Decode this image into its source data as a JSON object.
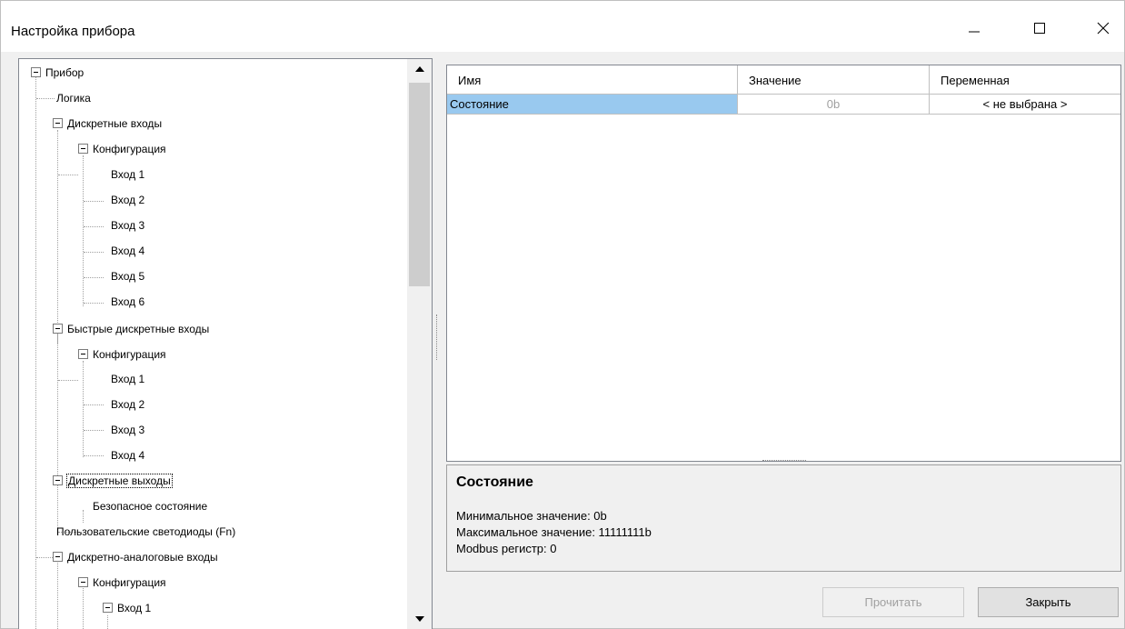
{
  "window": {
    "title": "Настройка прибора"
  },
  "tree": {
    "nodes": [
      {
        "label": "Прибор",
        "expanded": true
      },
      {
        "label": "Логика"
      },
      {
        "label": "Дискретные входы",
        "expanded": true
      },
      {
        "label": "Конфигурация",
        "expanded": true
      },
      {
        "label": "Вход 1"
      },
      {
        "label": "Вход 2"
      },
      {
        "label": "Вход 3"
      },
      {
        "label": "Вход 4"
      },
      {
        "label": "Вход 5"
      },
      {
        "label": "Вход 6"
      },
      {
        "label": "Быстрые дискретные входы",
        "expanded": true
      },
      {
        "label": "Конфигурация",
        "expanded": true
      },
      {
        "label": "Вход 1"
      },
      {
        "label": "Вход 2"
      },
      {
        "label": "Вход 3"
      },
      {
        "label": "Вход 4"
      },
      {
        "label": "Дискретные выходы",
        "expanded": true,
        "selected": true
      },
      {
        "label": "Безопасное состояние"
      },
      {
        "label": "Пользовательские светодиоды (Fn)"
      },
      {
        "label": "Дискретно-аналоговые входы",
        "expanded": true
      },
      {
        "label": "Конфигурация",
        "expanded": true
      },
      {
        "label": "Вход 1",
        "expanded": true
      }
    ]
  },
  "grid": {
    "columns": [
      "Имя",
      "Значение",
      "Переменная"
    ],
    "rows": [
      {
        "name": "Состояние",
        "value": "0b",
        "variable": "< не выбрана >"
      }
    ]
  },
  "info": {
    "title": "Состояние",
    "min": "Минимальное значение: 0b",
    "max": "Максимальное значение: 11111111b",
    "register": "Modbus регистр: 0"
  },
  "buttons": {
    "read": "Прочитать",
    "close": "Закрыть"
  },
  "colors": {
    "selection": "#99c9ef",
    "window_bg": "#f0f0f0"
  }
}
